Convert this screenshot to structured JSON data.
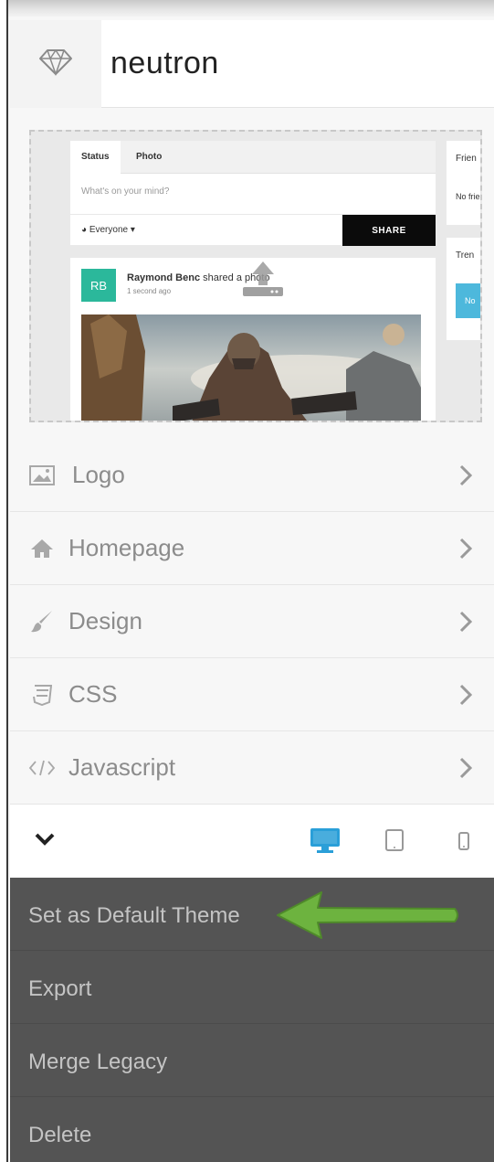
{
  "header": {
    "title": "neutron",
    "icon": "diamond-icon"
  },
  "preview": {
    "composer": {
      "tabs": [
        "Status",
        "Photo"
      ],
      "placeholder": "What's on your mind?",
      "privacy": "Everyone",
      "share_label": "SHARE"
    },
    "sidebar_cards": {
      "friends_title": "Frien",
      "friends_text": "No frie",
      "trending_title": "Tren",
      "trending_button": "No"
    },
    "post": {
      "avatar_initials": "RB",
      "author": "Raymond Benc",
      "action": " shared a photo",
      "time": "1 second ago"
    }
  },
  "menu": {
    "items": [
      {
        "label": "Logo",
        "icon": "image-icon"
      },
      {
        "label": "Homepage",
        "icon": "home-icon"
      },
      {
        "label": "Design",
        "icon": "paintbrush-icon"
      },
      {
        "label": "CSS",
        "icon": "css3-icon"
      },
      {
        "label": "Javascript",
        "icon": "code-icon"
      }
    ]
  },
  "devices": {
    "active": "desktop",
    "active_color": "#2a9fd8",
    "icons": [
      "desktop-icon",
      "tablet-icon",
      "phone-icon"
    ]
  },
  "actions": {
    "items": [
      "Set as Default Theme",
      "Export",
      "Merge Legacy",
      "Delete"
    ],
    "arrow_color": "#6db33f"
  }
}
